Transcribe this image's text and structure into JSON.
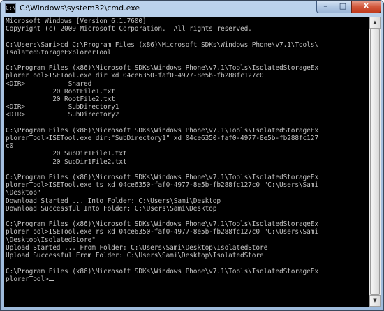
{
  "window": {
    "title": "C:\\Windows\\system32\\cmd.exe",
    "icon_text": "C:\\",
    "controls": {
      "minimize": "–",
      "maximize": "□",
      "close": "X"
    }
  },
  "console": {
    "lines": [
      "Microsoft Windows [Version 6.1.7600]",
      "Copyright (c) 2009 Microsoft Corporation.  All rights reserved.",
      "",
      "C:\\Users\\Sami>cd C:\\Program Files (x86)\\Microsoft SDKs\\Windows Phone\\v7.1\\Tools\\",
      "IsolatedStorageExplorerTool",
      "",
      "C:\\Program Files (x86)\\Microsoft SDKs\\Windows Phone\\v7.1\\Tools\\IsolatedStorageEx",
      "plorerTool>ISETool.exe dir xd 04ce6350-faf0-4977-8e5b-fb288fc127c0",
      "<DIR>           Shared",
      "            20 RootFile1.txt",
      "            20 RootFile2.txt",
      "<DIR>           SubDirectory1",
      "<DIR>           SubDirectory2",
      "",
      "C:\\Program Files (x86)\\Microsoft SDKs\\Windows Phone\\v7.1\\Tools\\IsolatedStorageEx",
      "plorerTool>ISETool.exe dir:\"SubDirectory1\" xd 04ce6350-faf0-4977-8e5b-fb288fc127",
      "c0",
      "            20 SubDir1File1.txt",
      "            20 SubDir1File2.txt",
      "",
      "C:\\Program Files (x86)\\Microsoft SDKs\\Windows Phone\\v7.1\\Tools\\IsolatedStorageEx",
      "plorerTool>ISETool.exe ts xd 04ce6350-faf0-4977-8e5b-fb288fc127c0 \"C:\\Users\\Sami",
      "\\Desktop\"",
      "Download Started ... Into Folder: C:\\Users\\Sami\\Desktop",
      "Download Successful Into Folder: C:\\Users\\Sami\\Desktop",
      "",
      "C:\\Program Files (x86)\\Microsoft SDKs\\Windows Phone\\v7.1\\Tools\\IsolatedStorageEx",
      "plorerTool>ISETool.exe rs xd 04ce6350-faf0-4977-8e5b-fb288fc127c0 \"C:\\Users\\Sami",
      "\\Desktop\\IsolatedStore\"",
      "Upload Started ... From Folder: C:\\Users\\Sami\\Desktop\\IsolatedStore",
      "Upload Successful From Folder: C:\\Users\\Sami\\Desktop\\IsolatedStore",
      "",
      "C:\\Program Files (x86)\\Microsoft SDKs\\Windows Phone\\v7.1\\Tools\\IsolatedStorageEx"
    ],
    "prompt": "plorerTool>",
    "colors": {
      "background": "#000000",
      "foreground": "#c0c0c0"
    }
  },
  "scrollbar": {
    "up_arrow": "▲",
    "down_arrow": "▼"
  }
}
